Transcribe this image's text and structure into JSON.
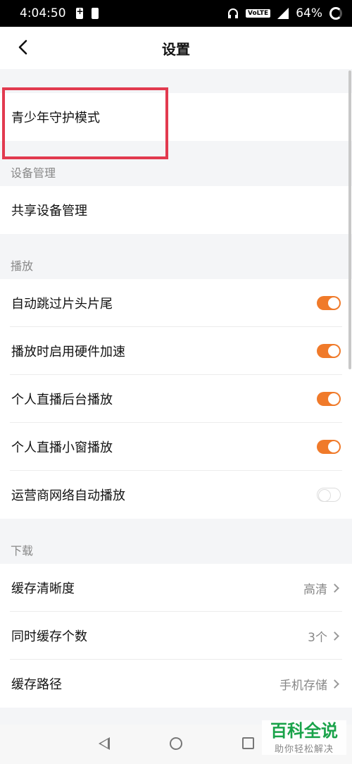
{
  "status_bar": {
    "time": "4:04:50",
    "network_badge": "VoLTE",
    "battery_percent": "64%"
  },
  "header": {
    "title": "设置"
  },
  "sections": {
    "top": {
      "items": [
        "青少年守护模式"
      ]
    },
    "device": {
      "title": "设备管理",
      "items": [
        "共享设备管理"
      ]
    },
    "playback": {
      "title": "播放",
      "items": [
        {
          "label": "自动跳过片头片尾",
          "on": true
        },
        {
          "label": "播放时启用硬件加速",
          "on": true
        },
        {
          "label": "个人直播后台播放",
          "on": true
        },
        {
          "label": "个人直播小窗播放",
          "on": true
        },
        {
          "label": "运营商网络自动播放",
          "on": false
        }
      ]
    },
    "download": {
      "title": "下载",
      "items": [
        {
          "label": "缓存清晰度",
          "value": "高清"
        },
        {
          "label": "同时缓存个数",
          "value": "3个"
        },
        {
          "label": "缓存路径",
          "value": "手机存储"
        }
      ]
    }
  },
  "watermark": {
    "main": "百科全说",
    "sub": "助你轻松解决"
  },
  "colors": {
    "accent": "#f07a2a",
    "highlight": "#e23a4f",
    "watermark": "#1aa34a"
  }
}
